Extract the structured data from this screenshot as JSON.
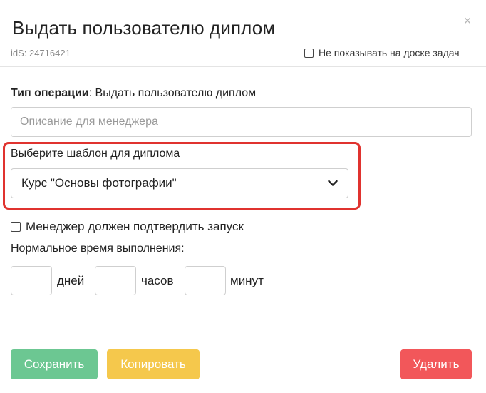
{
  "dialog": {
    "title": "Выдать пользователю диплом",
    "ids": "idS: 24716421",
    "hide_from_board_label": "Не показывать на доске задач",
    "close_glyph": "×"
  },
  "form": {
    "operation_type_label": "Тип операции",
    "operation_type_value": ": Выдать пользователю диплом",
    "manager_description_placeholder": "Описание для менеджера",
    "template_label": "Выберите шаблон для диплома",
    "template_selected": "Курс \"Основы фотографии\"",
    "manager_confirm_label": "Менеджер должен подтвердить запуск",
    "normal_time_label": "Нормальное время выполнения:",
    "days_label": "дней",
    "hours_label": "часов",
    "minutes_label": "минут"
  },
  "buttons": {
    "save": "Сохранить",
    "copy": "Копировать",
    "delete": "Удалить"
  },
  "colors": {
    "save": "#6cc792",
    "copy": "#f5c84c",
    "delete": "#f2575a",
    "highlight": "#e0332f"
  }
}
